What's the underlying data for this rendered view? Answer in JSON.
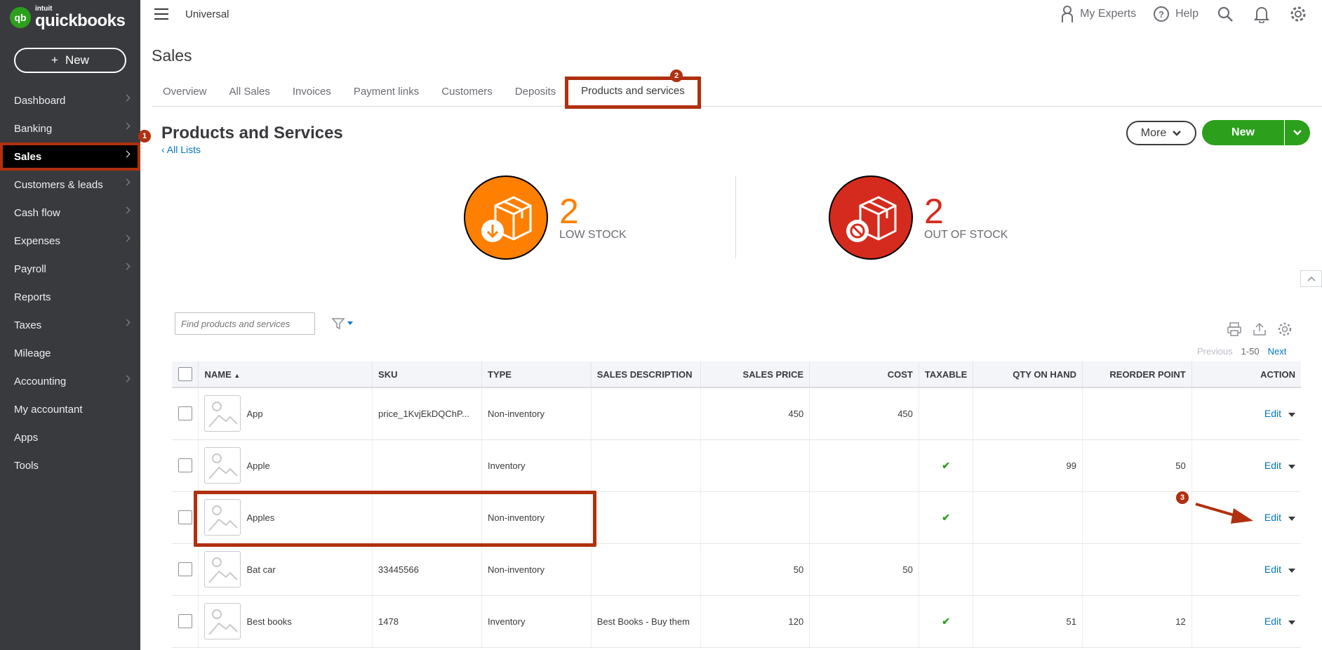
{
  "sidebar": {
    "logo_small": "intuit",
    "logo_big": "quickbooks",
    "logo_mark": "qb",
    "new_button": "New",
    "items": [
      {
        "label": "Dashboard",
        "chevron": true
      },
      {
        "label": "Banking",
        "chevron": true
      },
      {
        "label": "Sales",
        "chevron": true,
        "active": true
      },
      {
        "label": "Customers & leads",
        "chevron": true
      },
      {
        "label": "Cash flow",
        "chevron": true
      },
      {
        "label": "Expenses",
        "chevron": true
      },
      {
        "label": "Payroll",
        "chevron": true
      },
      {
        "label": "Reports",
        "chevron": false
      },
      {
        "label": "Taxes",
        "chevron": true
      },
      {
        "label": "Mileage",
        "chevron": false
      },
      {
        "label": "Accounting",
        "chevron": true
      },
      {
        "label": "My accountant",
        "chevron": false
      },
      {
        "label": "Apps",
        "chevron": false
      },
      {
        "label": "Tools",
        "chevron": false
      }
    ]
  },
  "topbar": {
    "company": "Universal",
    "my_experts": "My Experts",
    "help": "Help"
  },
  "page": {
    "title": "Sales",
    "tabs": [
      "Overview",
      "All Sales",
      "Invoices",
      "Payment links",
      "Customers",
      "Deposits",
      "Products and services"
    ],
    "active_tab": "Products and services",
    "section_title": "Products and Services",
    "all_lists": "All Lists",
    "more_button": "More",
    "new_button": "New"
  },
  "stock": {
    "low": {
      "count": "2",
      "label": "LOW STOCK",
      "color": "#ff8000"
    },
    "out": {
      "count": "2",
      "label": "OUT OF STOCK",
      "color": "#d52b1e"
    }
  },
  "table": {
    "search_placeholder": "Find products and services",
    "pager": {
      "previous": "Previous",
      "range": "1-50",
      "next": "Next"
    },
    "columns": [
      "NAME",
      "SKU",
      "TYPE",
      "SALES DESCRIPTION",
      "SALES PRICE",
      "COST",
      "TAXABLE",
      "QTY ON HAND",
      "REORDER POINT",
      "ACTION"
    ],
    "rows": [
      {
        "name": "App",
        "sku": "price_1KvjEkDQChP...",
        "type": "Non-inventory",
        "desc": "",
        "price": "450",
        "cost": "450",
        "taxable": false,
        "qty": "",
        "reorder": "",
        "action": "Edit"
      },
      {
        "name": "Apple",
        "sku": "",
        "type": "Inventory",
        "desc": "",
        "price": "",
        "cost": "",
        "taxable": true,
        "qty": "99",
        "reorder": "50",
        "action": "Edit"
      },
      {
        "name": "Apples",
        "sku": "",
        "type": "Non-inventory",
        "desc": "",
        "price": "",
        "cost": "",
        "taxable": true,
        "qty": "",
        "reorder": "",
        "action": "Edit"
      },
      {
        "name": "Bat car",
        "sku": "33445566",
        "type": "Non-inventory",
        "desc": "",
        "price": "50",
        "cost": "50",
        "taxable": false,
        "qty": "",
        "reorder": "",
        "action": "Edit"
      },
      {
        "name": "Best books",
        "sku": "1478",
        "type": "Inventory",
        "desc": "Best Books - Buy them",
        "price": "120",
        "cost": "",
        "taxable": true,
        "qty": "51",
        "reorder": "12",
        "action": "Edit"
      }
    ]
  },
  "annotations": {
    "step1": "1",
    "step2": "2",
    "step3": "3"
  },
  "colors": {
    "brand_green": "#2ca01c",
    "link_blue": "#0077c5",
    "annotation_red": "#b0300f",
    "sidebar_bg": "#393a3d"
  }
}
